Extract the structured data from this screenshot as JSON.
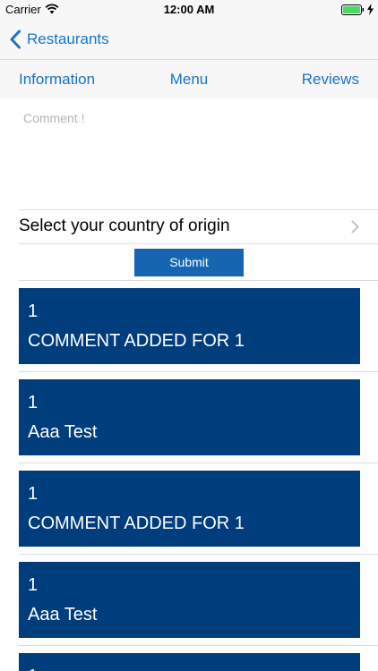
{
  "status_bar": {
    "carrier": "Carrier",
    "time": "12:00 AM",
    "icons": [
      "wifi-icon",
      "battery-icon",
      "charging-icon"
    ],
    "battery_color": "#4cd964"
  },
  "nav": {
    "back_label": "Restaurants",
    "back_icon": "chevron-left-icon"
  },
  "tabs": {
    "information": "Information",
    "menu": "Menu",
    "reviews": "Reviews"
  },
  "comment": {
    "placeholder": "Comment !",
    "value": ""
  },
  "country": {
    "label": "Select your country of origin",
    "icon": "chevron-right-icon"
  },
  "submit": {
    "label": "Submit"
  },
  "comments": [
    {
      "number": "1",
      "text": "COMMENT ADDED FOR 1"
    },
    {
      "number": "1",
      "text": "Aaa Test"
    },
    {
      "number": "1",
      "text": "COMMENT ADDED FOR 1"
    },
    {
      "number": "1",
      "text": "Aaa Test"
    },
    {
      "number": "1",
      "text": ""
    }
  ],
  "colors": {
    "accent": "#1a73c8",
    "card_background": "#003d7c",
    "submit_background": "#1565b0"
  }
}
